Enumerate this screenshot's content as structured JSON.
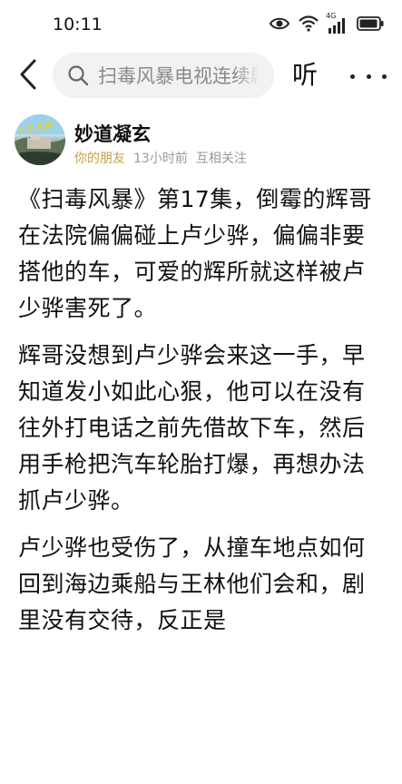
{
  "status_bar": {
    "time": "10:11",
    "network_label": "4G"
  },
  "header": {
    "search_text": "扫毒风暴电视连续剧",
    "listen_label": "听"
  },
  "author": {
    "name": "妙道凝玄",
    "avatar_badge": "江宁·天鹅",
    "friend_tag": "你的朋友",
    "time_ago": "13小时前",
    "relation": "互相关注"
  },
  "article": {
    "paragraphs": [
      "《扫毒风暴》第17集，倒霉的辉哥在法院偏偏碰上卢少骅，偏偏非要搭他的车，可爱的辉所就这样被卢少骅害死了。",
      "辉哥没想到卢少骅会来这一手，早知道发小如此心狠，他可以在没有往外打电话之前先借故下车，然后用手枪把汽车轮胎打爆，再想办法抓卢少骅。",
      "卢少骅也受伤了，从撞车地点如何回到海边乘船与王林他们会和，剧里没有交待，反正是"
    ]
  },
  "colors": {
    "friend_tag": "#c2a14a",
    "search_bg": "#f2f2f3",
    "meta_text": "#999999"
  }
}
